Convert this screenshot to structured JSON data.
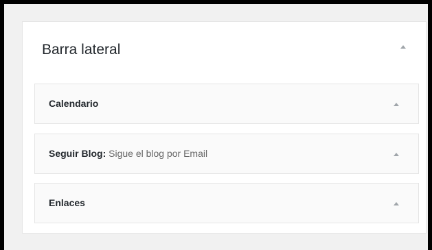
{
  "sidebar": {
    "title": "Barra lateral",
    "widgets": [
      {
        "name": "Calendario",
        "instance_separator": "",
        "instance_title": ""
      },
      {
        "name": "Seguir Blog",
        "instance_separator": ":",
        "instance_title": " Sigue el blog por Email"
      },
      {
        "name": "Enlaces",
        "instance_separator": "",
        "instance_title": ""
      }
    ]
  },
  "colors": {
    "frame": "#000000",
    "background": "#f1f1f1",
    "panel": "#ffffff",
    "widget_background": "#fafafa",
    "border": "#e5e5e5",
    "arrow": "#a0a5aa",
    "text": "#23282d"
  },
  "icons": {
    "toggle": "triangle-up-icon"
  }
}
